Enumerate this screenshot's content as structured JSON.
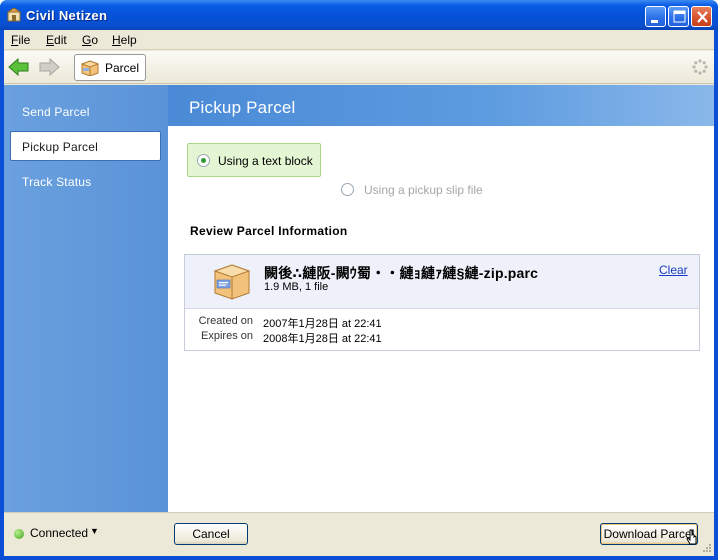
{
  "window": {
    "title": "Civil Netizen"
  },
  "menu": {
    "file": {
      "u": "F",
      "rest": "ile"
    },
    "edit": {
      "u": "E",
      "rest": "dit"
    },
    "go": {
      "u": "G",
      "rest": "o"
    },
    "help": {
      "u": "H",
      "rest": "elp"
    }
  },
  "toolbar": {
    "tab_label": "Parcel"
  },
  "sidebar": {
    "items": [
      "Send Parcel",
      "Pickup Parcel",
      "Track Status"
    ],
    "active": "Pickup Parcel"
  },
  "main": {
    "title": "Pickup Parcel",
    "options": [
      {
        "label": "Using a text block",
        "selected": true
      },
      {
        "label": "Using a pickup slip file",
        "selected": false
      }
    ],
    "section_title": "Review Parcel Information",
    "file": {
      "name": "闕後∴縺阪‐闕ｳ蜀・・縺ｮ縺ｧ縺§縺‐zip.parc",
      "meta": "1.9 MB, 1 file",
      "clear_label": "Clear",
      "created_label": "Created on",
      "created_value": "2007年1月28日 at 22:41",
      "expires_label": "Expires on",
      "expires_value": "2008年1月28日 at 22:41"
    }
  },
  "footer": {
    "status": "Connected",
    "status_color": "#3fa21e",
    "cancel_label": "Cancel",
    "download_label": "Download Parcel"
  },
  "colors": {
    "titlebar": "#0552d8",
    "sidebar": "#5a93d8",
    "header": "#4a8ad6",
    "selected_option_bg": "#e3f5d2"
  }
}
